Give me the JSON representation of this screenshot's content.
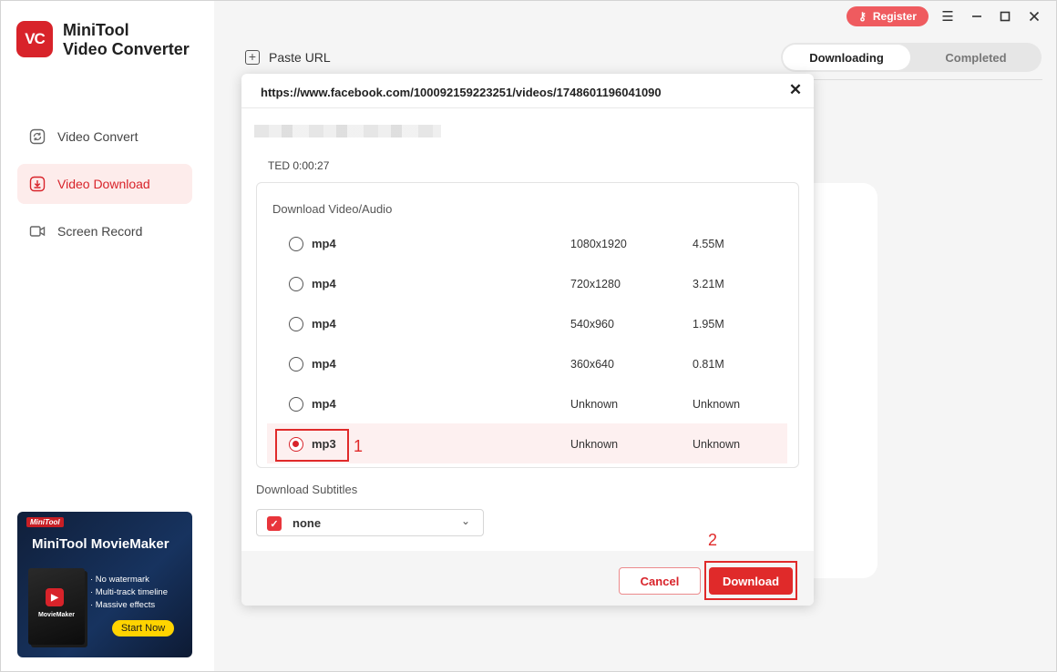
{
  "app": {
    "logo_text": "VC",
    "title_line1": "MiniTool",
    "title_line2": "Video Converter",
    "brand_color": "#d8232a"
  },
  "sidebar": {
    "items": [
      {
        "label": "Video Convert",
        "icon": "refresh-icon",
        "active": false
      },
      {
        "label": "Video Download",
        "icon": "download-icon",
        "active": true
      },
      {
        "label": "Screen Record",
        "icon": "camera-icon",
        "active": false
      }
    ]
  },
  "promo": {
    "tag": "MiniTool",
    "title": "MiniTool MovieMaker",
    "box_label": "MovieMaker",
    "features": [
      "· No watermark",
      "· Multi-track timeline",
      "· Massive effects"
    ],
    "cta": "Start Now"
  },
  "header": {
    "register_label": "Register",
    "paste_url_label": "Paste URL",
    "tabs": [
      {
        "label": "Downloading",
        "active": true
      },
      {
        "label": "Completed",
        "active": false
      }
    ]
  },
  "dialog": {
    "url": "https://www.facebook.com/100092159223251/videos/1748601196041090",
    "duration_text": "TED 0:00:27",
    "section_label": "Download Video/Audio",
    "options": [
      {
        "format": "mp4",
        "resolution": "1080x1920",
        "size": "4.55M",
        "selected": false
      },
      {
        "format": "mp4",
        "resolution": "720x1280",
        "size": "3.21M",
        "selected": false
      },
      {
        "format": "mp4",
        "resolution": "540x960",
        "size": "1.95M",
        "selected": false
      },
      {
        "format": "mp4",
        "resolution": "360x640",
        "size": "0.81M",
        "selected": false
      },
      {
        "format": "mp4",
        "resolution": "Unknown",
        "size": "Unknown",
        "selected": false
      },
      {
        "format": "mp3",
        "resolution": "Unknown",
        "size": "Unknown",
        "selected": true
      }
    ],
    "subtitles_label": "Download Subtitles",
    "subtitles_value": "none",
    "cancel_label": "Cancel",
    "download_label": "Download"
  },
  "annotations": {
    "step1": "1",
    "step2": "2",
    "color": "#e02a2a"
  }
}
